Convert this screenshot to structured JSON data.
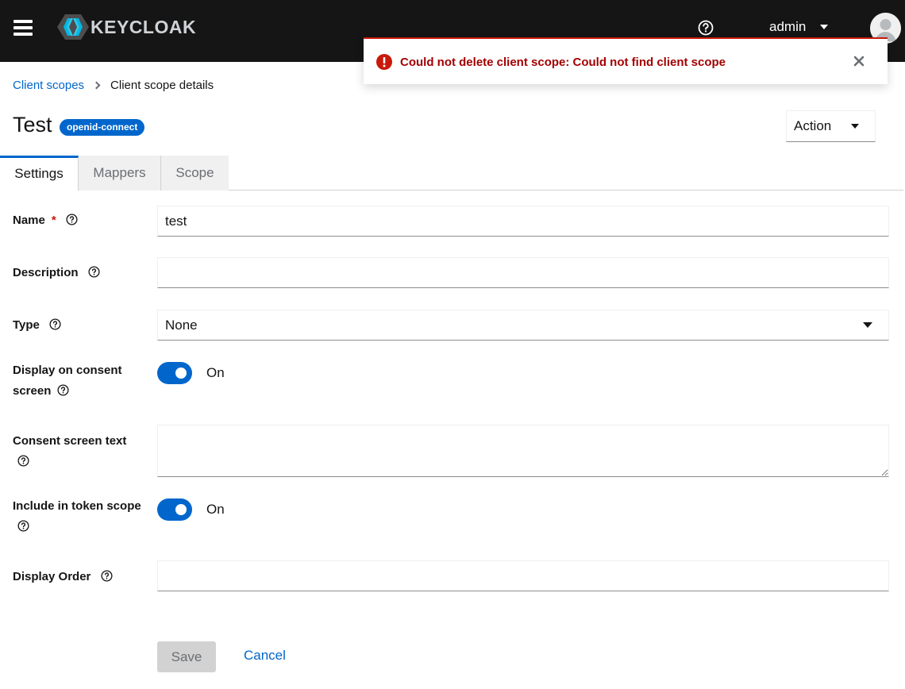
{
  "masthead": {
    "brand": "KEYCLOAK",
    "user": "admin",
    "icons": [
      "hamburger-icon",
      "keycloak-logo",
      "help-icon",
      "caret-down-icon",
      "avatar-icon"
    ]
  },
  "alert": {
    "variant": "danger",
    "title": "Could not delete client scope: Could not find client scope",
    "color": "#c9190b"
  },
  "breadcrumb": {
    "items": [
      {
        "label": "Client scopes",
        "link": true
      },
      {
        "label": "Client scope details",
        "link": false
      }
    ]
  },
  "header": {
    "title": "Test",
    "badge": "openid-connect",
    "action_label": "Action"
  },
  "tabs": [
    {
      "label": "Settings",
      "active": true
    },
    {
      "label": "Mappers",
      "active": false
    },
    {
      "label": "Scope",
      "active": false
    }
  ],
  "form": {
    "name": {
      "label": "Name",
      "required_mark": "*",
      "value": "test"
    },
    "description": {
      "label": "Description",
      "value": ""
    },
    "type": {
      "label": "Type",
      "value": "None"
    },
    "display_on_consent": {
      "label_line1": "Display on consent",
      "label_line2": "screen",
      "state_label": "On",
      "checked": true
    },
    "consent_text": {
      "label": "Consent screen text",
      "value": ""
    },
    "include_in_token": {
      "label": "Include in token scope",
      "state_label": "On",
      "checked": true
    },
    "display_order": {
      "label": "Display Order",
      "value": ""
    }
  },
  "buttons": {
    "save": "Save",
    "cancel": "Cancel"
  },
  "colors": {
    "primary": "#0066cc",
    "masthead": "#151515",
    "danger": "#c9190b"
  }
}
